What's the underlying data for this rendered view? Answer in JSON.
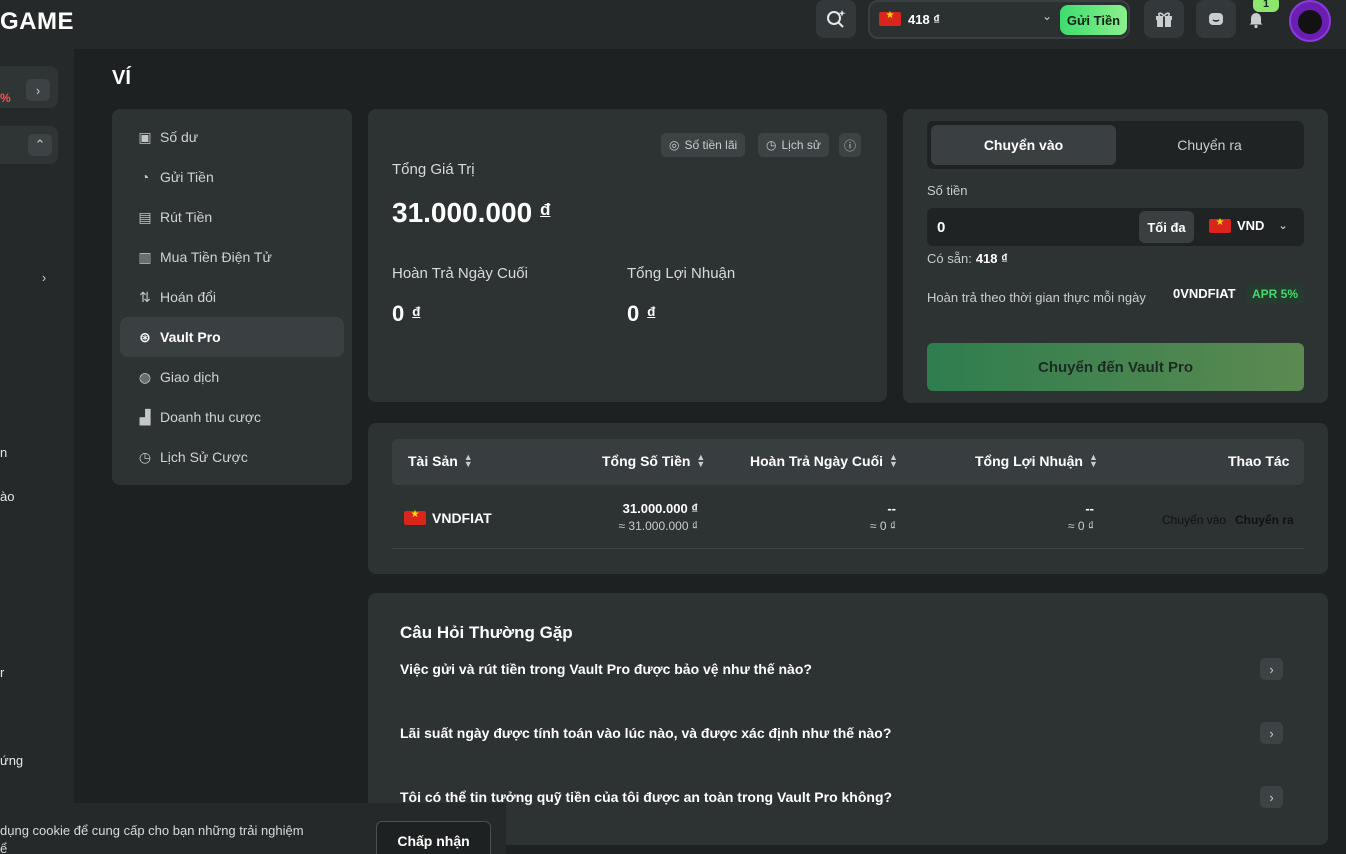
{
  "header": {
    "logo": "GAME",
    "wallet_balance": "418 ₫",
    "deposit_label": "Gửi Tiền",
    "notification_count": "1",
    "accent": "#3ddc6e"
  },
  "leftbar": {
    "promo_pct": "%",
    "fragments": [
      "n",
      "ào",
      "r",
      "ứng"
    ]
  },
  "page": {
    "title": "VÍ"
  },
  "menu": {
    "items": [
      {
        "label": "Số dư",
        "icon": "wallet-icon"
      },
      {
        "label": "Gửi Tiền",
        "icon": "piggy-bank-icon"
      },
      {
        "label": "Rút Tiền",
        "icon": "cash-withdraw-icon"
      },
      {
        "label": "Mua Tiền Điện Tử",
        "icon": "buy-crypto-icon"
      },
      {
        "label": "Hoán đổi",
        "icon": "swap-icon"
      },
      {
        "label": "Vault Pro",
        "icon": "vault-icon"
      },
      {
        "label": "Giao dịch",
        "icon": "transaction-icon"
      },
      {
        "label": "Doanh thu cược",
        "icon": "chart-icon"
      },
      {
        "label": "Lịch Sử Cược",
        "icon": "clock-icon"
      }
    ],
    "active": "Vault Pro"
  },
  "summary": {
    "interest_btn": "Số tiền lãi",
    "history_btn": "Lịch sử",
    "total_label": "Tổng Giá Trị",
    "total_value": "31.000.000",
    "currency_symbol": "đ",
    "refund_label": "Hoàn Trả Ngày Cuối",
    "refund_value": "0",
    "profit_label": "Tổng Lợi Nhuận",
    "profit_value": "0"
  },
  "transfer": {
    "tab_in": "Chuyển vào",
    "tab_out": "Chuyển ra",
    "amount_label": "Số tiền",
    "amount_value": "0",
    "max_label": "Tối đa",
    "currency": "VND",
    "available_label": "Có sẵn:",
    "available_value": "418 ₫",
    "refund_desc": "Hoàn trả theo thời gian thực mỗi ngày",
    "vault_id": "0VNDFIAT",
    "apr": "APR 5%",
    "submit_label": "Chuyển đến Vault Pro"
  },
  "assets": {
    "headers": [
      "Tài Sản",
      "Tổng Số Tiền",
      "Hoàn Trả Ngày Cuối",
      "Tổng Lợi Nhuận",
      "Thao Tác"
    ],
    "rows": [
      {
        "asset": "VNDFIAT",
        "total": "31.000.000 ₫",
        "total_sub": "≈ 31.000.000 ₫",
        "refund": "--",
        "refund_sub": "≈ 0 ₫",
        "profit": "--",
        "profit_sub": "≈ 0 ₫",
        "action_in": "Chuyển vào",
        "action_out": "Chuyển ra"
      }
    ]
  },
  "faq": {
    "title": "Câu Hỏi Thường Gặp",
    "questions": [
      "Việc gửi và rút tiền trong Vault Pro được bảo vệ như thế nào?",
      "Lãi suất ngày được tính toán vào lúc nào, và được xác định như thế nào?",
      "Tôi có thể tin tưởng quỹ tiền của tôi được an toàn trong Vault Pro không?"
    ]
  },
  "cookie": {
    "text": "dụng cookie để cung cấp cho bạn những trải nghiệm",
    "text2": "ể",
    "accept_label": "Chấp nhận"
  }
}
